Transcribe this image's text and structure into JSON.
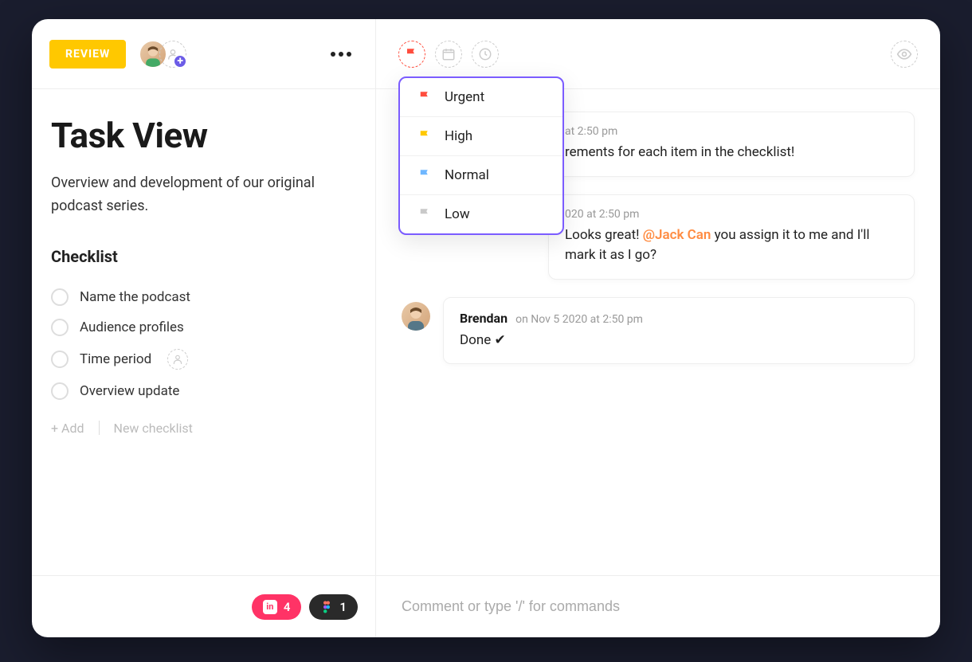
{
  "header": {
    "status_badge": "REVIEW"
  },
  "task": {
    "title": "Task View",
    "description": "Overview and development of our original podcast series."
  },
  "checklist": {
    "title": "Checklist",
    "items": [
      {
        "label": "Name the podcast",
        "has_assignee_slot": false
      },
      {
        "label": "Audience profiles",
        "has_assignee_slot": false
      },
      {
        "label": "Time period",
        "has_assignee_slot": true
      },
      {
        "label": "Overview update",
        "has_assignee_slot": false
      }
    ],
    "add_label": "+ Add",
    "new_checklist_label": "New checklist"
  },
  "attachments": {
    "invision_count": "4",
    "figma_count": "1"
  },
  "priority": {
    "options": [
      {
        "label": "Urgent",
        "color": "#ff4d3d"
      },
      {
        "label": "High",
        "color": "#ffc800"
      },
      {
        "label": "Normal",
        "color": "#6fb7ff"
      },
      {
        "label": "Low",
        "color": "#c9c9c9"
      }
    ]
  },
  "comments": [
    {
      "partial": true,
      "timestamp_suffix": "at 2:50 pm",
      "body_suffix": "rements for each item in the checklist!"
    },
    {
      "partial": true,
      "timestamp": "020 at 2:50 pm",
      "body_pre": "Looks great! ",
      "mention": "@Jack Can",
      "body_post": " you assign it to me and I'll mark it as I go?"
    },
    {
      "author": "Brendan",
      "timestamp": "on Nov 5 2020 at 2:50 pm",
      "body": "Done ✔"
    }
  ],
  "composer": {
    "placeholder": "Comment or type '/' for commands"
  }
}
